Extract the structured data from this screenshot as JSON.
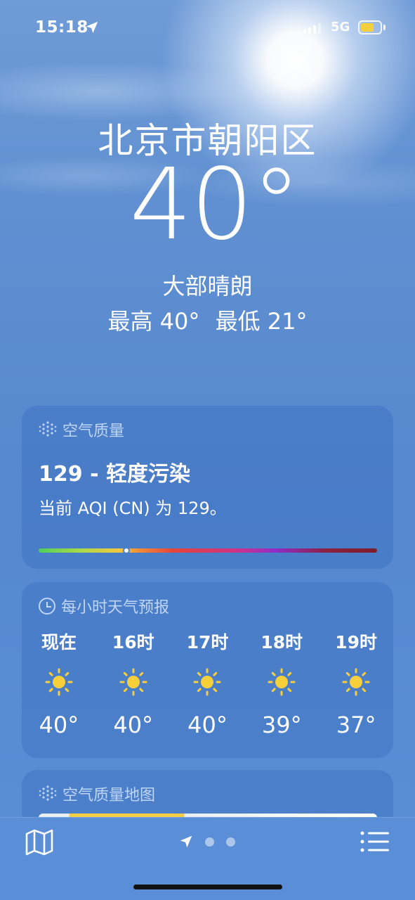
{
  "status_bar": {
    "time": "15:18",
    "network": "5G",
    "battery_level": 0.7,
    "battery_color": "#f5d03d",
    "location_icon": "location-arrow-icon"
  },
  "hero": {
    "city": "北京市朝阳区",
    "temperature": "40°",
    "condition": "大部晴朗",
    "high": "最高 40°",
    "low": "最低 21°"
  },
  "air_quality": {
    "header": "空气质量",
    "icon": "air-quality-icon",
    "value_label": "129 - 轻度污染",
    "description": "当前 AQI (CN) 为 129。",
    "index": 129,
    "scale_position": 0.26
  },
  "hourly": {
    "header": "每小时天气预报",
    "icon": "clock-icon",
    "hours": [
      {
        "label": "现在",
        "temp": "40°",
        "icon": "sun-icon"
      },
      {
        "label": "16时",
        "temp": "40°",
        "icon": "sun-icon"
      },
      {
        "label": "17时",
        "temp": "40°",
        "icon": "sun-icon"
      },
      {
        "label": "18时",
        "temp": "39°",
        "icon": "sun-icon"
      },
      {
        "label": "19时",
        "temp": "37°",
        "icon": "sun-icon"
      }
    ]
  },
  "air_quality_map": {
    "header": "空气质量地图",
    "icon": "air-quality-icon"
  },
  "bottom_bar": {
    "left_icon": "map-icon",
    "right_icon": "list-icon",
    "page_count": 2
  },
  "colors": {
    "sun": "#f7cf3a",
    "aqi_yellow": "#f3cf45"
  }
}
